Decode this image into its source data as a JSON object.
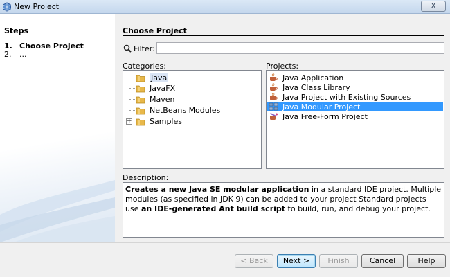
{
  "window": {
    "title": "New Project",
    "close_glyph": "X"
  },
  "steps": {
    "title": "Steps",
    "items": [
      {
        "num": "1.",
        "label": "Choose Project"
      },
      {
        "num": "2.",
        "label": "..."
      }
    ]
  },
  "main": {
    "title": "Choose Project",
    "filter": {
      "label": "Filter:",
      "value": "",
      "placeholder": ""
    },
    "categories_label": "Categories:",
    "projects_label": "Projects:",
    "categories": [
      {
        "label": "Java",
        "selected": true,
        "expandable": false
      },
      {
        "label": "JavaFX",
        "selected": false,
        "expandable": false
      },
      {
        "label": "Maven",
        "selected": false,
        "expandable": false
      },
      {
        "label": "NetBeans Modules",
        "selected": false,
        "expandable": false
      },
      {
        "label": "Samples",
        "selected": false,
        "expandable": true,
        "expander": "+"
      }
    ],
    "projects": [
      {
        "label": "Java Application",
        "icon": "java-cup-icon",
        "selected": false
      },
      {
        "label": "Java Class Library",
        "icon": "java-cup-icon",
        "selected": false
      },
      {
        "label": "Java Project with Existing Sources",
        "icon": "java-cup-icon",
        "selected": false
      },
      {
        "label": "Java Modular Project",
        "icon": "modular-project-icon",
        "selected": true
      },
      {
        "label": "Java Free-Form Project",
        "icon": "freeform-project-icon",
        "selected": false
      }
    ],
    "description_label": "Description:",
    "description": {
      "b1": "Creates a new Java SE modular application",
      "t1": " in a standard IDE project. Multiple modules (as specified in JDK 9) can be added to your project Standard projects use ",
      "b2": "an IDE-generated Ant build script",
      "t2": " to build, run, and debug your project."
    }
  },
  "buttons": {
    "back": "< Back",
    "next": "Next >",
    "finish": "Finish",
    "cancel": "Cancel",
    "help": "Help"
  },
  "colors": {
    "selection": "#3399ff",
    "titlebar": "#c4d7ed",
    "folder": "#e8b84a"
  }
}
